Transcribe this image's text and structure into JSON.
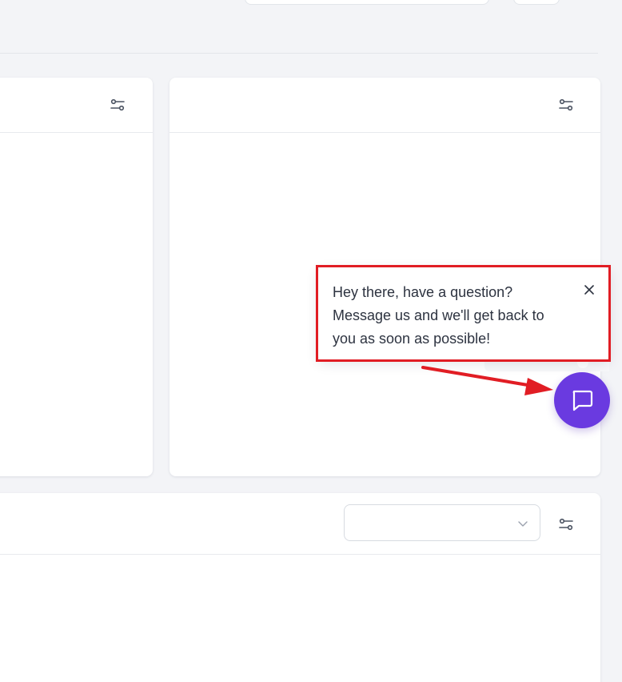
{
  "chat_popup": {
    "message_line_1": "Hey there, have a question?",
    "message_line_2": "Message us and we'll get back to",
    "message_line_3": "you as soon as possible!"
  },
  "dropdown": {
    "selected_value": ""
  },
  "icons": {
    "filter": "filter-sliders-icon",
    "close": "close-icon",
    "chevron": "chevron-down-icon",
    "chat": "chat-bubble-icon"
  },
  "colors": {
    "page_background": "#f3f4f7",
    "card_background": "#ffffff",
    "chat_launcher": "#6a3ae0",
    "annotation": "#e11d24",
    "icon": "#4a5261"
  }
}
